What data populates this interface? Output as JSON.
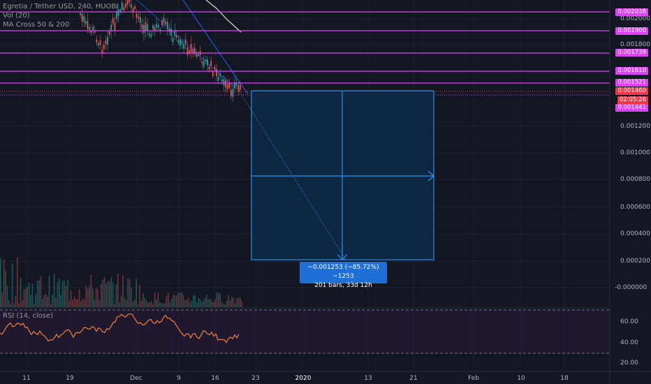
{
  "legend": {
    "symbol": "Egretia / Tether USD, 240, HUOBI",
    "vol": "Vol (20)",
    "ma": "MA Cross 50 & 200"
  },
  "rsi_legend": "RSI (14, close)",
  "price_levels": [
    {
      "value": "0.002038",
      "kind": "line"
    },
    {
      "value": "0.001900",
      "kind": "line"
    },
    {
      "value": "0.001739",
      "kind": "line"
    },
    {
      "value": "0.001610",
      "kind": "line"
    },
    {
      "value": "0.001521",
      "kind": "line"
    },
    {
      "value": "0.001441",
      "kind": "line"
    }
  ],
  "current_price": "0.001460",
  "countdown": "02:05:26",
  "y_axis": [
    "0.002000",
    "0.001800",
    "0.001200",
    "0.001000",
    "0.000800",
    "0.000600",
    "0.000400",
    "0.000200",
    "-0.000000"
  ],
  "rsi_axis": [
    "60.00",
    "40.00",
    "20.00"
  ],
  "x_axis": [
    "11",
    "19",
    "Dec",
    "9",
    "16",
    "23",
    "2020",
    "13",
    "21",
    "Feb",
    "10",
    "18"
  ],
  "measure": {
    "line1": "−0.001253 (−85.72%) −1253",
    "line2": "201 bars, 33d 12h"
  },
  "colors": {
    "background": "#131722",
    "level_line": "#e040fb",
    "current_price": "#f23645",
    "measure": "#2196f3"
  }
}
